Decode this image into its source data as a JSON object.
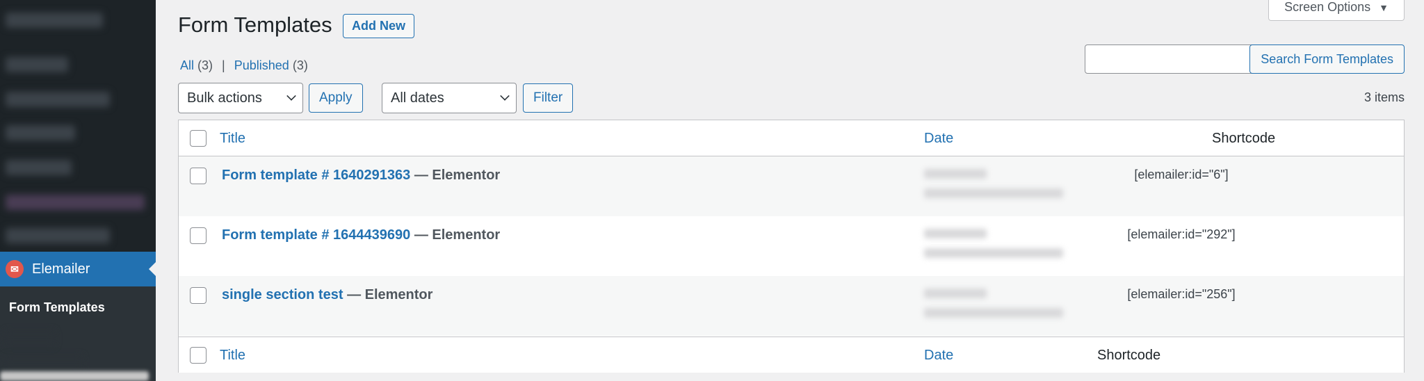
{
  "sidebar": {
    "active_menu": "Elemailer",
    "active_icon": "elemailer-logo-icon",
    "current_submenu": "Form Templates"
  },
  "screen_options": {
    "label": "Screen Options",
    "caret": "▼"
  },
  "header": {
    "title": "Form Templates",
    "add_new": "Add New"
  },
  "views": {
    "all_label": "All",
    "all_count": "(3)",
    "separator": "|",
    "published_label": "Published",
    "published_count": "(3)"
  },
  "search": {
    "value": "",
    "button": "Search Form Templates"
  },
  "tablenav": {
    "bulk_actions": "Bulk actions",
    "apply": "Apply",
    "dates": "All dates",
    "filter": "Filter",
    "items_count": "3 items"
  },
  "table": {
    "columns": {
      "title": "Title",
      "date": "Date",
      "shortcode": "Shortcode"
    },
    "rows": [
      {
        "title": "Form template # 1640291363",
        "state": "— Elementor",
        "shortcode": "[elemailer:id=\"6\"]"
      },
      {
        "title": "Form template # 1644439690",
        "state": "— Elementor",
        "shortcode": "[elemailer:id=\"292\"]"
      },
      {
        "title": "single section test",
        "state": "— Elementor",
        "shortcode": "[elemailer:id=\"256\"]"
      }
    ]
  }
}
